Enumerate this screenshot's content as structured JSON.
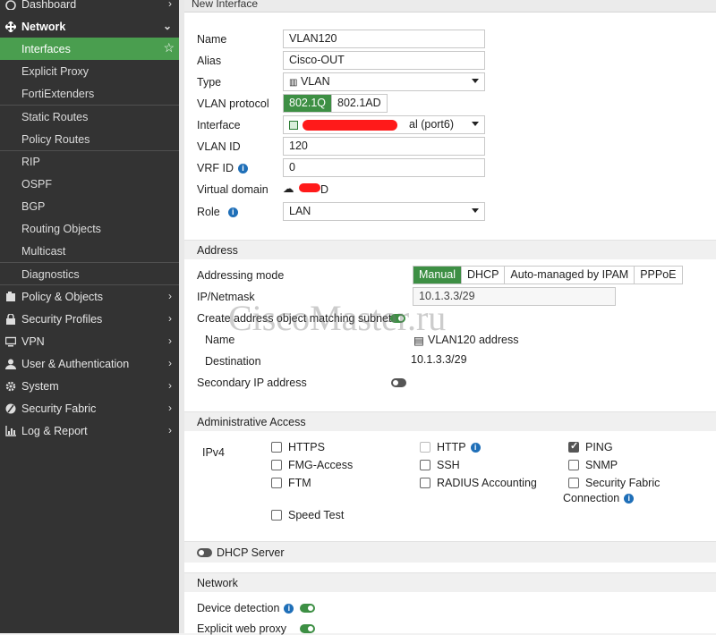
{
  "sidebar": {
    "dashboard": "Dashboard",
    "network": "Network",
    "items": [
      {
        "label": "Interfaces"
      },
      {
        "label": "Explicit Proxy"
      },
      {
        "label": "FortiExtenders"
      },
      {
        "label": "Static Routes"
      },
      {
        "label": "Policy Routes"
      },
      {
        "label": "RIP"
      },
      {
        "label": "OSPF"
      },
      {
        "label": "BGP"
      },
      {
        "label": "Routing Objects"
      },
      {
        "label": "Multicast"
      },
      {
        "label": "Diagnostics"
      }
    ],
    "groups": [
      {
        "label": "Policy & Objects",
        "icon": "policy-icon"
      },
      {
        "label": "Security Profiles",
        "icon": "lock-icon"
      },
      {
        "label": "VPN",
        "icon": "monitor-icon"
      },
      {
        "label": "User & Authentication",
        "icon": "user-icon"
      },
      {
        "label": "System",
        "icon": "gear-icon"
      },
      {
        "label": "Security Fabric",
        "icon": "fabric-icon"
      },
      {
        "label": "Log & Report",
        "icon": "chart-icon"
      }
    ]
  },
  "page": {
    "title": "New Interface"
  },
  "form": {
    "name_label": "Name",
    "name_value": "VLAN120",
    "alias_label": "Alias",
    "alias_value": "Cisco-OUT",
    "type_label": "Type",
    "type_value": "VLAN",
    "vlan_protocol_label": "VLAN protocol",
    "vlan_protocol_options": [
      "802.1Q",
      "802.1AD"
    ],
    "interface_label": "Interface",
    "interface_value": "al (port6)",
    "vlan_id_label": "VLAN ID",
    "vlan_id_value": "120",
    "vrf_id_label": "VRF ID",
    "vrf_id_value": "0",
    "virtual_domain_label": "Virtual domain",
    "virtual_domain_value": "D",
    "role_label": "Role",
    "role_value": "LAN"
  },
  "address": {
    "section_title": "Address",
    "mode_label": "Addressing mode",
    "mode_options": [
      "Manual",
      "DHCP",
      "Auto-managed by IPAM",
      "PPPoE"
    ],
    "ip_label": "IP/Netmask",
    "ip_value": "10.1.3.3/29",
    "create_obj_label": "Create address object matching subnet",
    "name_label": "Name",
    "name_value": "VLAN120 address",
    "destination_label": "Destination",
    "destination_value": "10.1.3.3/29",
    "secondary_label": "Secondary IP address"
  },
  "admin_access": {
    "section_title": "Administrative Access",
    "ipv4_label": "IPv4",
    "col1": [
      "HTTPS",
      "FMG-Access",
      "FTM",
      "Speed Test"
    ],
    "col2": [
      "HTTP",
      "SSH",
      "RADIUS Accounting"
    ],
    "col3": [
      "PING",
      "SNMP",
      "Security Fabric"
    ],
    "col3_extra": "Connection"
  },
  "dhcp": {
    "label": "DHCP Server"
  },
  "network_section": {
    "section_title": "Network",
    "device_detection_label": "Device detection",
    "explicit_proxy_label": "Explicit web proxy"
  },
  "watermark": "CiscoMaster.ru",
  "colors": {
    "accent": "#3d8f44",
    "sidebar_bg": "#333333",
    "info": "#1f6fb8"
  }
}
